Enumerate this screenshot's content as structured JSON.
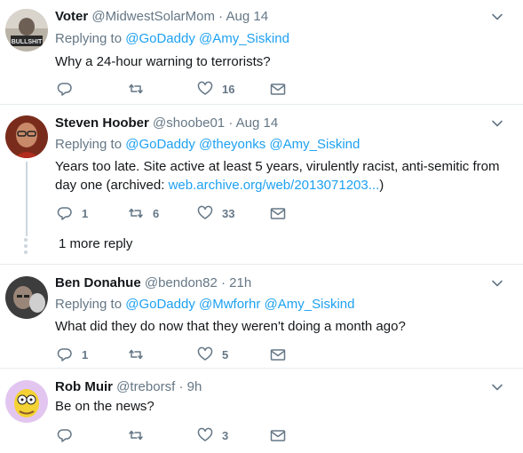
{
  "tweets": [
    {
      "name": "Voter",
      "handle": "@MidwestSolarMom",
      "time": "Aug 14",
      "replying_label": "Replying to",
      "mentions": "@GoDaddy @Amy_Siskind",
      "text": "Why a 24-hour warning to terrorists?",
      "replies": "",
      "retweets": "",
      "likes": "16",
      "avatar_text": "BULLSHIT"
    },
    {
      "name": "Steven Hoober",
      "handle": "@shoobe01",
      "time": "Aug 14",
      "replying_label": "Replying to",
      "mentions": "@GoDaddy @theyonks @Amy_Siskind",
      "text_before": "Years too late. Site active at least 5 years, virulently racist, anti-semitic from day one (archived: ",
      "link": "web.archive.org/web/2013071203...",
      "text_after": ")",
      "replies": "1",
      "retweets": "6",
      "likes": "33"
    },
    {
      "name": "Ben Donahue",
      "handle": "@bendon82",
      "time": "21h",
      "replying_label": "Replying to",
      "mentions": "@GoDaddy @Mwforhr @Amy_Siskind",
      "text": "What did they do now that they weren't doing a month ago?",
      "replies": "1",
      "retweets": "",
      "likes": "5"
    },
    {
      "name": "Rob Muir",
      "handle": "@treborsf",
      "time": "9h",
      "text": "Be on the news?",
      "replies": "",
      "retweets": "",
      "likes": "3"
    }
  ],
  "more_replies_label": "1 more reply",
  "separator": "·",
  "colors": {
    "link": "#1da1f2",
    "secondary": "#657786",
    "primary": "#14171a",
    "divider": "#e6ecf0",
    "thread_line": "#ccd6dd"
  }
}
